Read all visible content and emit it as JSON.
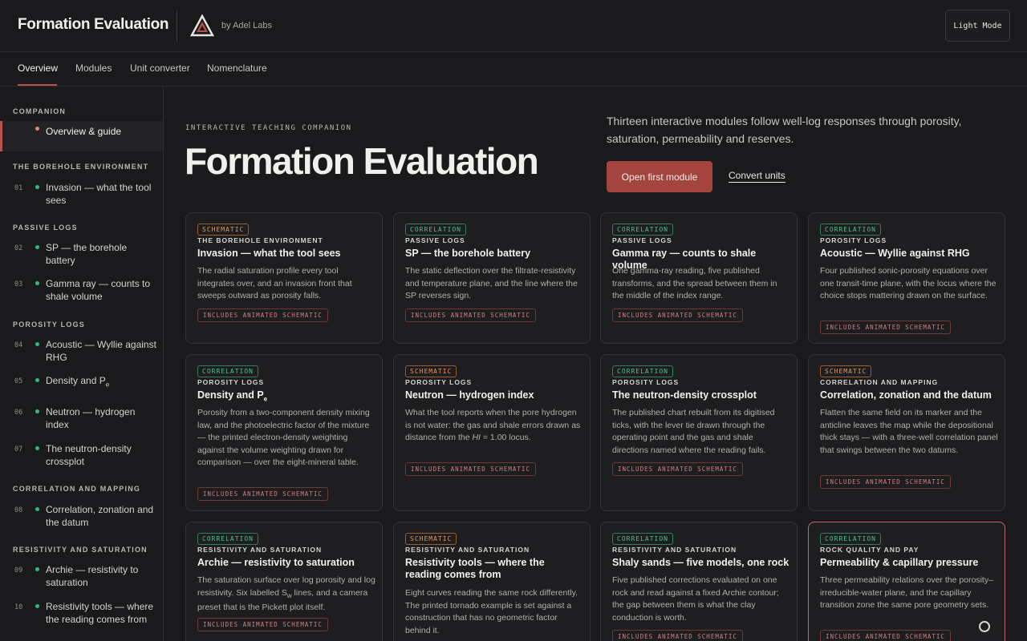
{
  "header": {
    "title": "Formation Evaluation",
    "byline": "by Adel Labs",
    "mode_button": "Light Mode"
  },
  "nav": {
    "tabs": [
      "Overview",
      "Modules",
      "Unit converter",
      "Nomenclature"
    ]
  },
  "sidebar": {
    "sections": [
      "COMPANION",
      "THE BOREHOLE ENVIRONMENT",
      "PASSIVE LOGS",
      "POROSITY LOGS",
      "CORRELATION AND MAPPING",
      "RESISTIVITY AND SATURATION"
    ],
    "items": [
      {
        "num": "",
        "label": "Overview & guide"
      },
      {
        "num": "01",
        "label": "Invasion — what the tool sees"
      },
      {
        "num": "02",
        "label": "SP — the borehole battery"
      },
      {
        "num": "03",
        "label": "Gamma ray — counts to shale volume"
      },
      {
        "num": "04",
        "label": "Acoustic — Wyllie against RHG"
      },
      {
        "num": "05",
        "label": "Density and P"
      },
      {
        "num": "06",
        "label": "Neutron — hydrogen index"
      },
      {
        "num": "07",
        "label": "The neutron-density crossplot"
      },
      {
        "num": "08",
        "label": "Correlation, zonation and the datum"
      },
      {
        "num": "09",
        "label": "Archie — resistivity to saturation"
      },
      {
        "num": "10",
        "label": "Resistivity tools — where the reading comes from"
      }
    ]
  },
  "hero": {
    "eyebrow": "INTERACTIVE TEACHING COMPANION",
    "title": "Formation Evaluation",
    "description": "Thirteen interactive modules follow well-log responses through porosity, saturation, permeability and reserves.",
    "primary_button": "Open first module",
    "secondary_link": "Convert units"
  },
  "pill_label": "INCLUDES ANIMATED SCHEMATIC",
  "sub_e": "e",
  "sub_w": "w",
  "cards": [
    {
      "tag": "SCHEMATIC",
      "category": "THE BOREHOLE ENVIRONMENT",
      "title": "Invasion — what the tool sees",
      "desc": "The radial saturation profile every tool integrates over, and an invasion front that sweeps outward as porosity falls."
    },
    {
      "tag": "CORRELATION",
      "category": "PASSIVE LOGS",
      "title": "SP — the borehole battery",
      "desc": "The static deflection over the filtrate-resistivity and temperature plane, and the line where the SP reverses sign."
    },
    {
      "tag": "CORRELATION",
      "category": "PASSIVE LOGS",
      "title": "Gamma ray — counts to shale volume",
      "desc": "One gamma-ray reading, five published transforms, and the spread between them in the middle of the index range."
    },
    {
      "tag": "CORRELATION",
      "category": "POROSITY LOGS",
      "title": "Acoustic — Wyllie against RHG",
      "desc": "Four published sonic-porosity equations over one transit-time plane, with the locus where the choice stops mattering drawn on the surface."
    },
    {
      "tag": "CORRELATION",
      "category": "POROSITY LOGS",
      "title": "Density and P",
      "desc": "Porosity from a two-component density mixing law, and the photoelectric factor of the mixture — the printed electron-density weighting against the volume weighting drawn for comparison — over the eight-mineral table."
    },
    {
      "tag": "SCHEMATIC",
      "category": "POROSITY LOGS",
      "title": "Neutron — hydrogen index",
      "desc_a": "What the tool reports when the pore hydrogen is not water: the gas and shale errors drawn as distance from the ",
      "desc_hi": "HI",
      "desc_b": " = 1.00 locus."
    },
    {
      "tag": "CORRELATION",
      "category": "POROSITY LOGS",
      "title": "The neutron-density crossplot",
      "desc": "The published chart rebuilt from its digitised ticks, with the lever tie drawn through the operating point and the gas and shale directions named where the reading fails."
    },
    {
      "tag": "SCHEMATIC",
      "category": "CORRELATION AND MAPPING",
      "title": "Correlation, zonation and the datum",
      "desc": "Flatten the same field on its marker and the anticline leaves the map while the depositional thick stays — with a three-well correlation panel that swings between the two datums."
    },
    {
      "tag": "CORRELATION",
      "category": "RESISTIVITY AND SATURATION",
      "title": "Archie — resistivity to saturation",
      "desc_a": "The saturation surface over log porosity and log resistivity. Six labelled S",
      "desc_b": " lines, and a camera preset that is the Pickett plot itself."
    },
    {
      "tag": "SCHEMATIC",
      "category": "RESISTIVITY AND SATURATION",
      "title": "Resistivity tools — where the reading comes from",
      "desc": "Eight curves reading the same rock differently. The printed tornado example is set against a construction that has no geometric factor behind it."
    },
    {
      "tag": "CORRELATION",
      "category": "RESISTIVITY AND SATURATION",
      "title": "Shaly sands — five models, one rock",
      "desc": "Five published corrections evaluated on one rock and read against a fixed Archie contour; the gap between them is what the clay conduction is worth."
    },
    {
      "tag": "CORRELATION",
      "category": "ROCK QUALITY AND PAY",
      "title": "Permeability & capillary pressure",
      "desc": "Three permeability relations over the porosity–irreducible-water plane, and the capillary transition zone the same pore geometry sets."
    }
  ],
  "colors": {
    "accent": "#a3443f",
    "correlation": "#4cc08c",
    "schematic": "#e3995a",
    "background": "#1a1a1c"
  },
  "icons": [
    "logo-triangle-icon",
    "status-dot-icon",
    "chat-circle-icon"
  ]
}
